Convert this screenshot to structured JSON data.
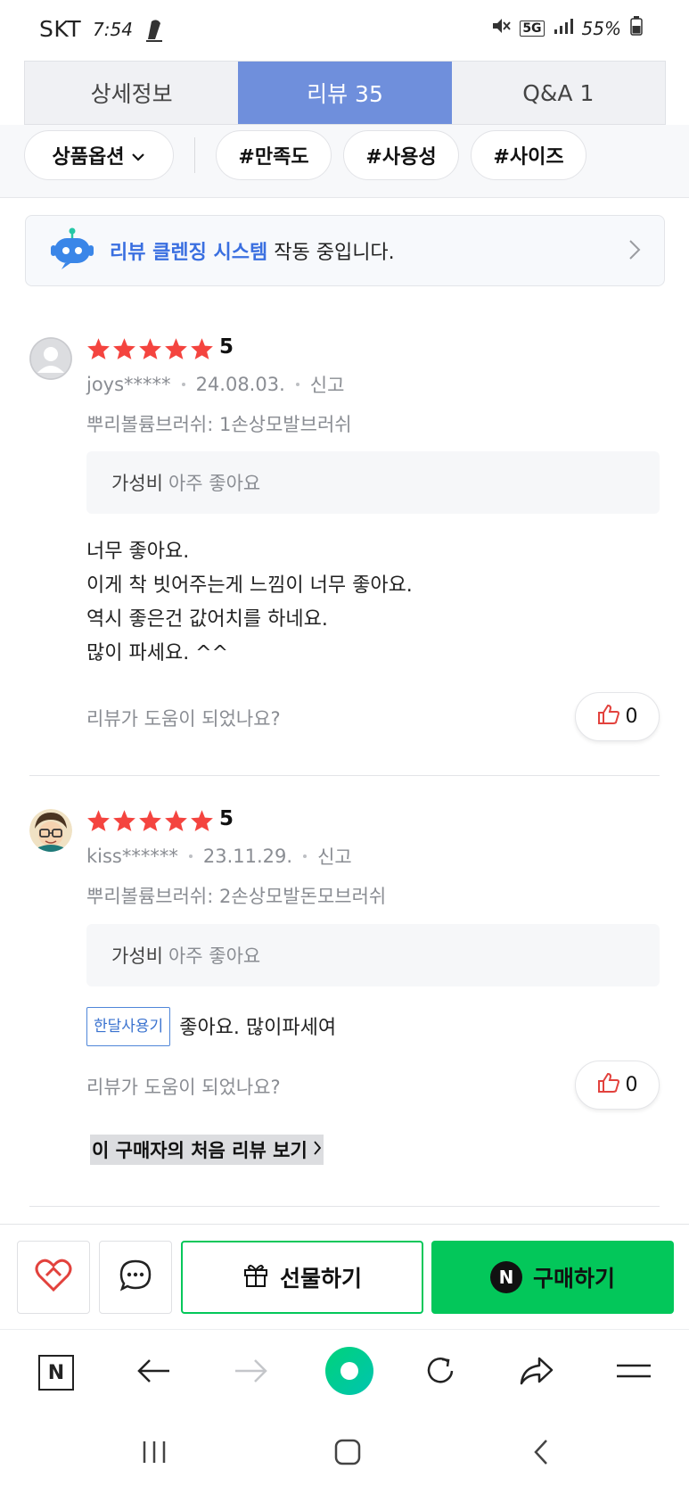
{
  "status_bar": {
    "carrier": "SKT",
    "time": "7:54",
    "network": "5G",
    "battery": "55%"
  },
  "tabs": [
    {
      "label": "상세정보",
      "active": false
    },
    {
      "label": "리뷰  35",
      "active": true
    },
    {
      "label": "Q&A  1",
      "active": false
    }
  ],
  "filters": {
    "option_label": "상품옵션",
    "chips": [
      "#만족도",
      "#사용성",
      "#사이즈"
    ]
  },
  "banner": {
    "highlight": "리뷰 클렌징 시스템",
    "text": " 작동 중입니다."
  },
  "reviews": [
    {
      "rating": "5",
      "rating_value": 5,
      "user": "joys*****",
      "date": "24.08.03.",
      "report": "신고",
      "option": "뿌리볼륨브러쉬: 1손상모발브러쉬",
      "eval_key": "가성비",
      "eval_value": "아주 좋아요",
      "body_lines": [
        "너무 좋아요.",
        "이게 착 빗어주는게 느낌이 너무 좋아요.",
        "역시 좋은건 값어치를 하네요.",
        "많이 파세요. ^^"
      ],
      "helpful_question": "리뷰가 도움이 되었나요?",
      "likes": "0"
    },
    {
      "rating": "5",
      "rating_value": 5,
      "user": "kiss******",
      "date": "23.11.29.",
      "report": "신고",
      "option": "뿌리볼륨브러쉬: 2손상모발돈모브러쉬",
      "eval_key": "가성비",
      "eval_value": "아주 좋아요",
      "badge": "한달사용기",
      "body": "좋아요. 많이파세여",
      "helpful_question": "리뷰가 도움이 되었나요?",
      "likes": "0",
      "first_review_link": "이 구매자의 처음 리뷰 보기"
    }
  ],
  "action_bar": {
    "gift_label": "선물하기",
    "buy_label": "구매하기",
    "buy_logo": "N"
  },
  "browser_bar": {
    "home_logo": "N"
  },
  "colors": {
    "tab_active": "#6f8fdc",
    "star": "#f4443f",
    "naver_green": "#03c75a",
    "banner_highlight": "#3a6fe0"
  }
}
